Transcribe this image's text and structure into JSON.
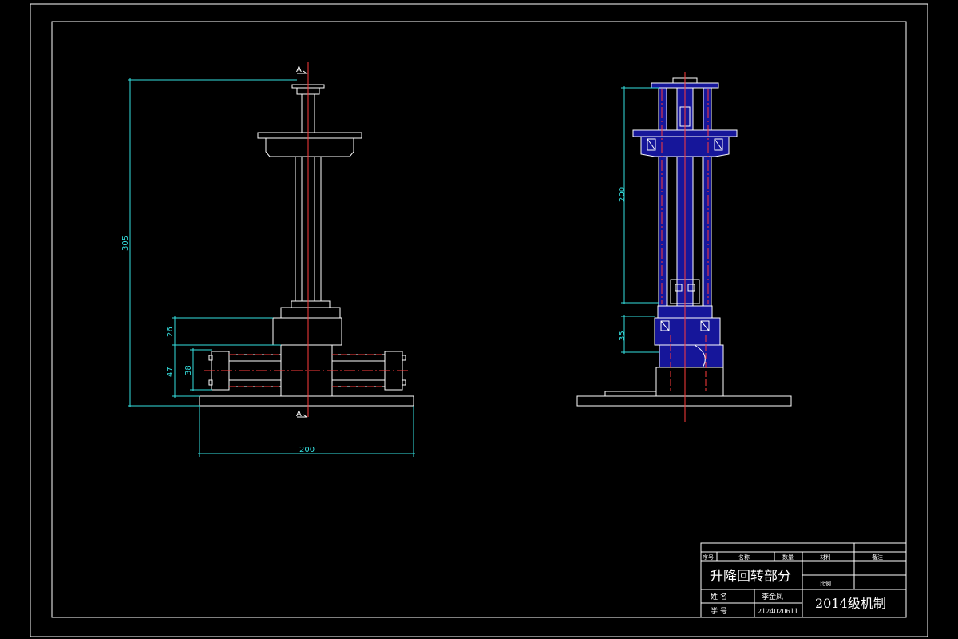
{
  "colors": {
    "background": "#000000",
    "outline": "#ffffff",
    "dimension": "#35e0e0",
    "centerline": "#ff3b3b",
    "section_fill": "#16169a"
  },
  "front_view": {
    "section_mark_top": "A",
    "section_mark_bottom": "A",
    "dimensions": {
      "overall_height": "305",
      "base_width": "200",
      "block_height": "26",
      "lower_height_outer": "47",
      "lower_height_inner": "38"
    }
  },
  "section_view": {
    "dimensions": {
      "column_height": "200",
      "block_height": "35"
    }
  },
  "title_block": {
    "header": {
      "index": "序号",
      "name": "名称",
      "quantity": "数量",
      "material": "材料",
      "remarks": "备注"
    },
    "title": "升降回转部分",
    "scale_label": "比例",
    "name_label": "姓  名",
    "name_value": "李金凤",
    "id_label": "学  号",
    "id_value": "2124020611",
    "class_label": "2014级机制"
  }
}
